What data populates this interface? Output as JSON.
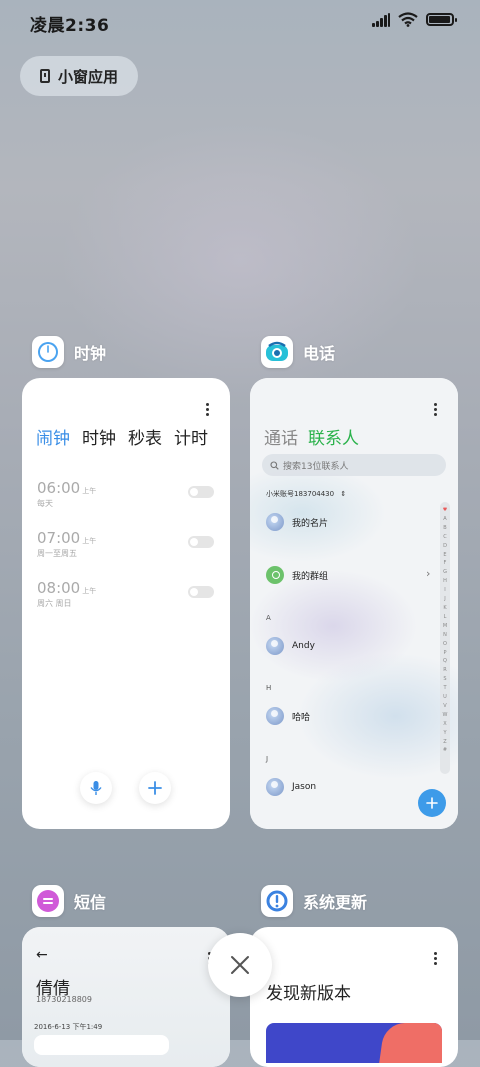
{
  "status_bar": {
    "time": "凌晨2:36"
  },
  "pill": {
    "label": "小窗应用"
  },
  "apps": {
    "clock": {
      "name": "时钟",
      "tabs": [
        "闹钟",
        "时钟",
        "秒表",
        "计时"
      ],
      "alarms": [
        {
          "time": "06:00",
          "ampm": "上午",
          "repeat": "每天"
        },
        {
          "time": "07:00",
          "ampm": "上午",
          "repeat": "周一至周五"
        },
        {
          "time": "08:00",
          "ampm": "上午",
          "repeat": "周六 周日"
        }
      ]
    },
    "phone": {
      "name": "电话",
      "tabs": [
        "通话",
        "联系人"
      ],
      "search_placeholder": "搜索13位联系人",
      "account": "小米账号183704430",
      "contacts": [
        {
          "name": "我的名片"
        },
        {
          "name": "我的群组"
        },
        {
          "letter": "A",
          "name": "Andy"
        },
        {
          "letter": "H",
          "name": "哈哈"
        },
        {
          "letter": "J",
          "name": "Jason"
        }
      ],
      "index_letters": [
        "♥",
        "A",
        "B",
        "C",
        "D",
        "E",
        "F",
        "G",
        "H",
        "I",
        "J",
        "K",
        "L",
        "M",
        "N",
        "O",
        "P",
        "Q",
        "R",
        "S",
        "T",
        "U",
        "V",
        "W",
        "X",
        "Y",
        "Z",
        "#"
      ]
    },
    "sms": {
      "name": "短信",
      "contact": "倩倩",
      "number": "18730218809",
      "date": "2016-6-13 下午1:49"
    },
    "update": {
      "name": "系统更新",
      "title": "发现新版本"
    }
  },
  "colors": {
    "accent_blue": "#3a8ee6",
    "accent_green": "#2bb24c"
  }
}
